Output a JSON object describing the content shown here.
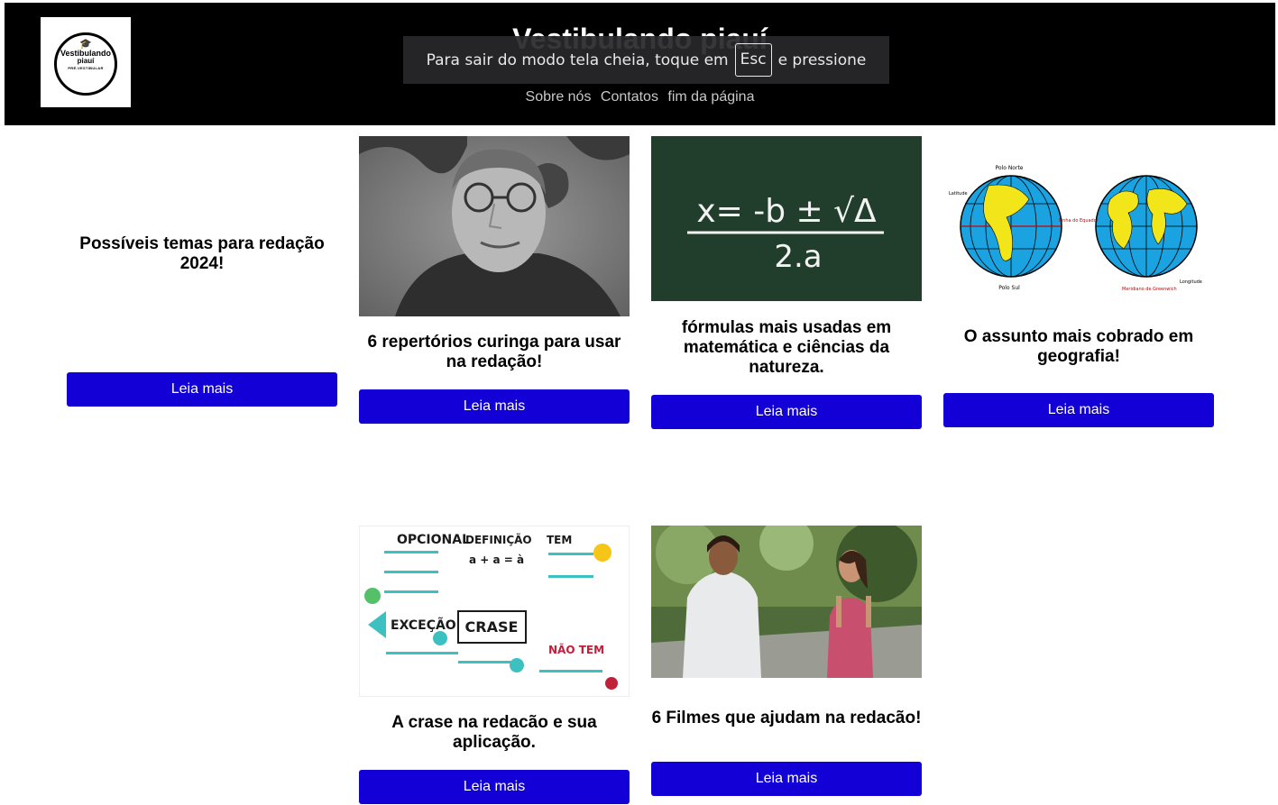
{
  "header": {
    "title": "Vestibulando piauí",
    "logo": {
      "line1": "Vestibulando",
      "line2": "piauí",
      "line3": "PRÉ-VESTIBULAR"
    },
    "nav": [
      "Sobre nós",
      "Contatos",
      "fim da página"
    ]
  },
  "fullscreen_notice": {
    "before": "Para sair do modo tela cheia, toque em",
    "key": "Esc",
    "after": "e pressione"
  },
  "cards": [
    {
      "title": "Possíveis temas para redação 2024!",
      "button": "Leia mais"
    },
    {
      "title": "6 repertórios curinga para usar na redação!",
      "button": "Leia mais"
    },
    {
      "title": "fórmulas mais usadas em matemática e ciências da natureza.",
      "button": "Leia mais"
    },
    {
      "title": "O assunto mais cobrado em geografia!",
      "button": "Leia mais"
    },
    {
      "title": "A crase na redacão e sua aplicação.",
      "button": "Leia mais"
    },
    {
      "title": "6 Filmes que ajudam na redacão!",
      "button": "Leia mais"
    }
  ],
  "images": {
    "formula_numerator": "x= -b ± √Δ",
    "formula_denominator": "2.a",
    "globe_labels": {
      "north": "Polo Norte",
      "south": "Polo Sul",
      "equator": "Linha do Equador",
      "greenwich": "Meridiano de Greenwich",
      "latitude": "Latitude",
      "longitude": "Longitude"
    },
    "crase_words": [
      "OPCIONAL",
      "DEFINIÇÃO",
      "TEM",
      "a + a = à",
      "EXCEÇÃO",
      "CRASE",
      "NÃO TEM"
    ]
  }
}
